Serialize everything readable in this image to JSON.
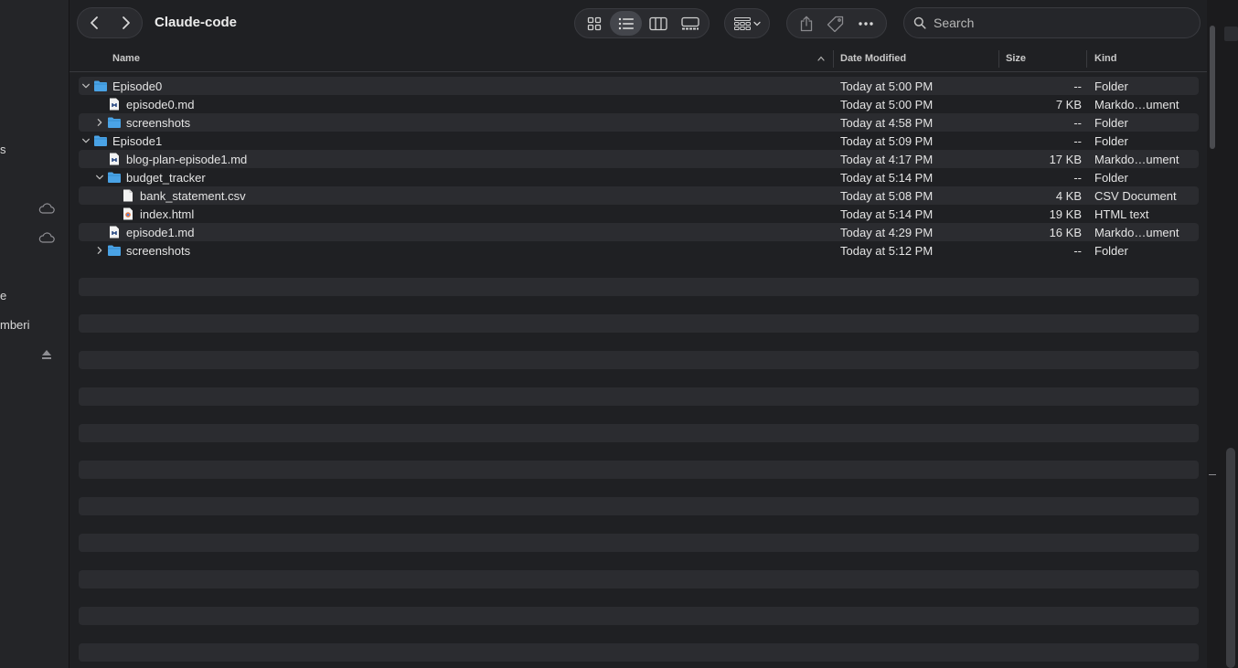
{
  "window": {
    "title": "Claude-code"
  },
  "sidebar": {
    "fragments": [
      "s",
      "e",
      "mberi"
    ]
  },
  "search": {
    "placeholder": "Search",
    "value": ""
  },
  "columns": {
    "name": "Name",
    "date": "Date Modified",
    "size": "Size",
    "kind": "Kind"
  },
  "rows": [
    {
      "name": "Episode0",
      "date": "Today at 5:00 PM",
      "size": "--",
      "kind": "Folder",
      "type": "folder",
      "level": 0,
      "expanded": true
    },
    {
      "name": "episode0.md",
      "date": "Today at 5:00 PM",
      "size": "7 KB",
      "kind": "Markdo…ument",
      "type": "md",
      "level": 1
    },
    {
      "name": "screenshots",
      "date": "Today at 4:58 PM",
      "size": "--",
      "kind": "Folder",
      "type": "folder",
      "level": 1,
      "expanded": false
    },
    {
      "name": "Episode1",
      "date": "Today at 5:09 PM",
      "size": "--",
      "kind": "Folder",
      "type": "folder",
      "level": 0,
      "expanded": true
    },
    {
      "name": "blog-plan-episode1.md",
      "date": "Today at 4:17 PM",
      "size": "17 KB",
      "kind": "Markdo…ument",
      "type": "md",
      "level": 1
    },
    {
      "name": "budget_tracker",
      "date": "Today at 5:14 PM",
      "size": "--",
      "kind": "Folder",
      "type": "folder",
      "level": 1,
      "expanded": true
    },
    {
      "name": "bank_statement.csv",
      "date": "Today at 5:08 PM",
      "size": "4 KB",
      "kind": "CSV Document",
      "type": "csv",
      "level": 2
    },
    {
      "name": "index.html",
      "date": "Today at 5:14 PM",
      "size": "19 KB",
      "kind": "HTML text",
      "type": "html",
      "level": 2
    },
    {
      "name": "episode1.md",
      "date": "Today at 4:29 PM",
      "size": "16 KB",
      "kind": "Markdo…ument",
      "type": "md",
      "level": 1
    },
    {
      "name": "screenshots",
      "date": "Today at 5:12 PM",
      "size": "--",
      "kind": "Folder",
      "type": "folder",
      "level": 1,
      "expanded": false
    }
  ],
  "icons": {
    "back": "chevron-left-icon",
    "forward": "chevron-right-icon",
    "views": [
      "icon-view-icon",
      "list-view-icon",
      "column-view-icon",
      "gallery-view-icon"
    ],
    "group": "group-by-icon",
    "actions": [
      "share-icon",
      "tag-icon",
      "more-icon"
    ],
    "search": "search-icon"
  },
  "colors": {
    "folder": "#4aa3e6",
    "background": "#1f2023",
    "stripe": "#2b2c30"
  }
}
